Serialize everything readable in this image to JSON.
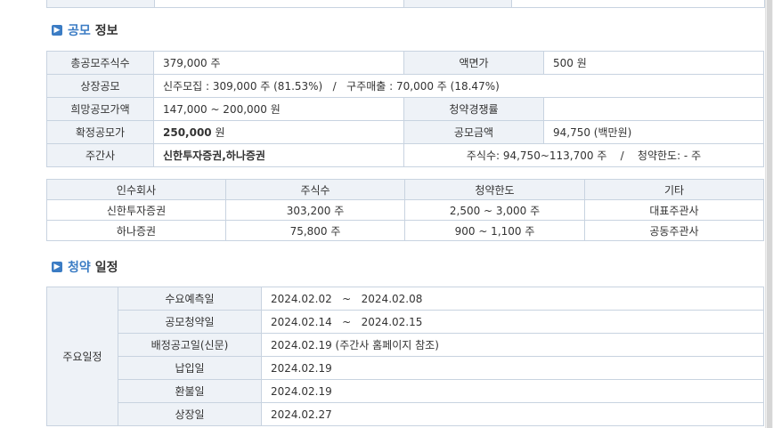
{
  "offering_section": {
    "title_highlight": "공모",
    "title_rest": "정보"
  },
  "offering_info": {
    "total_shares_label": "총공모주식수",
    "total_shares_value": "379,000 주",
    "par_value_label": "액면가",
    "par_value_value": "500 원",
    "listing_offering_label": "상장공모",
    "listing_offering_value": "신주모집 : 309,000 주 (81.53%)   /   구주매출 : 70,000 주 (18.47%)",
    "desired_price_label": "희망공모가액",
    "desired_price_value": "147,000 ~ 200,000 원",
    "competition_label": "청약경쟁률",
    "competition_value": "",
    "final_price_label": "확정공모가",
    "final_price_number": "250,000",
    "final_price_unit": " 원",
    "offering_amount_label": "공모금액",
    "offering_amount_value": "94,750 (백만원)",
    "underwriter_label": "주간사",
    "underwriter_value": "신한투자증권,하나증권",
    "underwriter_detail": "주식수: 94,750~113,700 주    /    청약한도: - 주"
  },
  "underwriters_table": {
    "headers": [
      "인수회사",
      "주식수",
      "청약한도",
      "기타"
    ],
    "rows": [
      [
        "신한투자증권",
        "303,200 주",
        "2,500 ~ 3,000 주",
        "대표주관사"
      ],
      [
        "하나증권",
        "75,800 주",
        "900 ~ 1,100 주",
        "공동주관사"
      ]
    ]
  },
  "schedule_section": {
    "title_highlight": "청약",
    "title_rest": "일정"
  },
  "schedule": {
    "group_label": "주요일정",
    "rows": [
      [
        "수요예측일",
        "2024.02.02   ~   2024.02.08"
      ],
      [
        "공모청약일",
        "2024.02.14   ~   2024.02.15"
      ],
      [
        "배정공고일(신문)",
        "2024.02.19 (주간사 홈페이지 참조)"
      ],
      [
        "납입일",
        "2024.02.19"
      ],
      [
        "환불일",
        "2024.02.19"
      ],
      [
        "상장일",
        "2024.02.27"
      ]
    ]
  },
  "colors": {
    "accent": "#3b7cc4",
    "header_bg": "#eef2f7",
    "border": "#c8d3e0"
  }
}
